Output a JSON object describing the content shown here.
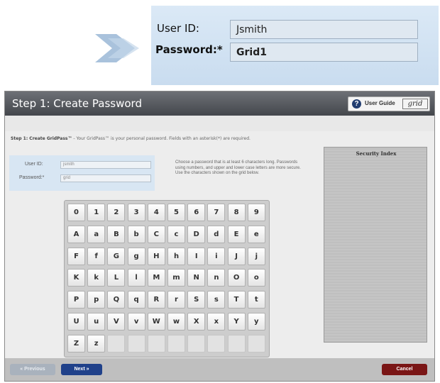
{
  "zoom": {
    "user_id_label": "User ID:",
    "user_id_value": "Jsmith",
    "password_label": "Password:*",
    "password_value": "Grid1"
  },
  "window": {
    "title": "Step 1: Create Password",
    "user_guide_label": "User Guide",
    "logo_text": "grid"
  },
  "instructions": {
    "bold_part": "Step 1: Create GridPass™",
    "rest": " - Your GridPass™ is your personal password. Fields with an asterisk(*) are required."
  },
  "form": {
    "user_id_label": "User ID:",
    "user_id_value": "jsmith",
    "password_label": "Password:*",
    "password_value": "grid"
  },
  "help_text": "Choose a password that is at least 6 characters long. Passwords using numbers, and upper and lower case letters are more secure. Use the characters shown on the grid below.",
  "keypad_keys": [
    [
      "0",
      "1",
      "2",
      "3",
      "4",
      "5",
      "6",
      "7",
      "8",
      "9"
    ],
    [
      "A",
      "a",
      "B",
      "b",
      "C",
      "c",
      "D",
      "d",
      "E",
      "e"
    ],
    [
      "F",
      "f",
      "G",
      "g",
      "H",
      "h",
      "I",
      "i",
      "J",
      "j"
    ],
    [
      "K",
      "k",
      "L",
      "l",
      "M",
      "m",
      "N",
      "n",
      "O",
      "o"
    ],
    [
      "P",
      "p",
      "Q",
      "q",
      "R",
      "r",
      "S",
      "s",
      "T",
      "t"
    ],
    [
      "U",
      "u",
      "V",
      "v",
      "W",
      "w",
      "X",
      "x",
      "Y",
      "y"
    ],
    [
      "Z",
      "z",
      "",
      "",
      "",
      "",
      "",
      "",
      "",
      ""
    ]
  ],
  "security_panel_title": "Security Index",
  "footer": {
    "previous_label": "« Previous",
    "next_label": "Next »",
    "cancel_label": "Cancel"
  },
  "colors": {
    "title_bar": "#55585d",
    "next_button": "#20418a",
    "cancel_button": "#7a1616",
    "form_highlight": "#d8e6f3"
  }
}
